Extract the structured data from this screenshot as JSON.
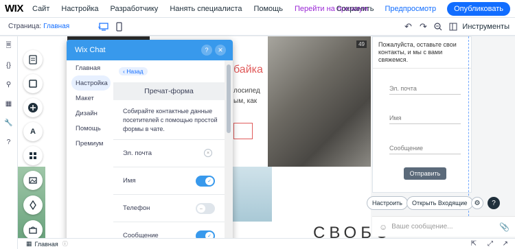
{
  "topbar": {
    "logo": "WIX",
    "nav": [
      "Сайт",
      "Настройка",
      "Разработчику",
      "Нанять специалиста",
      "Помощь"
    ],
    "premium": "Перейти на премиум",
    "save": "Сохранить",
    "preview": "Предпросмотр",
    "publish": "Опубликовать"
  },
  "bar2": {
    "page_label": "Страница:",
    "page_value": "Главная",
    "tools": "Инструменты"
  },
  "site": {
    "red_text": "байка",
    "body_text": "лосипед ым, как",
    "photo_number": "49",
    "big_word": "СВОБО"
  },
  "widget": {
    "intro": "Пожалуйста, оставьте свои контакты, и мы с вами свяжемся.",
    "fields": [
      "Эл. почта",
      "Имя",
      "Сообщение"
    ],
    "send": "Отправить",
    "customize": "Настроить",
    "open_inbox": "Открыть Входящие",
    "message_placeholder": "Ваше сообщение..."
  },
  "panel": {
    "title": "Wix Chat",
    "menu": [
      "Главная",
      "Настройка",
      "Макет",
      "Дизайн",
      "Помощь",
      "Премиум"
    ],
    "back": "Назад",
    "section_title": "Пречат-форма",
    "description": "Собирайте контактные данные посетителей с помощью простой формы в чате.",
    "rows": [
      {
        "label": "Эл. почта",
        "state": "locked"
      },
      {
        "label": "Имя",
        "state": "on"
      },
      {
        "label": "Телефон",
        "state": "off"
      },
      {
        "label": "Сообщение",
        "state": "on"
      }
    ]
  },
  "bottombar": {
    "page": "Главная"
  },
  "colors": {
    "accent": "#116dff",
    "panel_header": "#3899ec",
    "premium": "#9a27d5"
  }
}
